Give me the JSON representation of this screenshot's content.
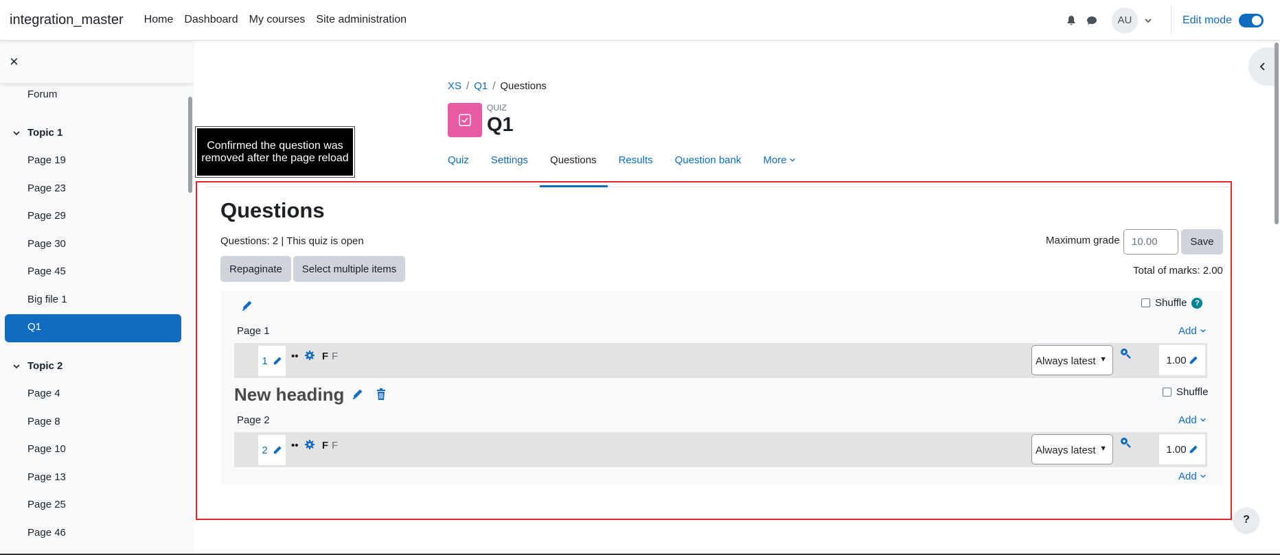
{
  "topnav": {
    "site_name": "integration_master",
    "links": [
      "Home",
      "Dashboard",
      "My courses",
      "Site administration"
    ],
    "user_initials": "AU",
    "edit_mode_label": "Edit mode",
    "edit_mode_on": true
  },
  "drawer": {
    "close_icon": "×",
    "items": [
      {
        "type": "item",
        "label": "Forum"
      },
      {
        "type": "section",
        "label": "Topic 1"
      },
      {
        "type": "item",
        "label": "Page 19"
      },
      {
        "type": "item",
        "label": "Page 23"
      },
      {
        "type": "item",
        "label": "Page 29"
      },
      {
        "type": "item",
        "label": "Page 30"
      },
      {
        "type": "item",
        "label": "Page 45"
      },
      {
        "type": "item",
        "label": "Big file 1"
      },
      {
        "type": "active",
        "label": "Q1"
      },
      {
        "type": "section",
        "label": "Topic 2"
      },
      {
        "type": "item",
        "label": "Page 4"
      },
      {
        "type": "item",
        "label": "Page 8"
      },
      {
        "type": "item",
        "label": "Page 10"
      },
      {
        "type": "item",
        "label": "Page 13"
      },
      {
        "type": "item",
        "label": "Page 25"
      },
      {
        "type": "item",
        "label": "Page 46"
      }
    ]
  },
  "tooltip": "Confirmed the question was removed after the page reload",
  "breadcrumb": [
    "XS",
    "Q1",
    "Questions"
  ],
  "activity": {
    "type_label": "QUIZ",
    "title": "Q1",
    "icon_color": "#e95aa5"
  },
  "tabs": [
    "Quiz",
    "Settings",
    "Questions",
    "Results",
    "Question bank",
    "More"
  ],
  "active_tab": "Questions",
  "questions": {
    "heading": "Questions",
    "status": "Questions: 2 | This quiz is open",
    "repaginate_label": "Repaginate",
    "select_multiple_label": "Select multiple items",
    "max_grade_label": "Maximum grade",
    "max_grade_value": "10.00",
    "save_label": "Save",
    "total_marks": "Total of marks: 2.00",
    "shuffle_label": "Shuffle",
    "add_label": "Add",
    "section_heading": "New heading",
    "pages": [
      {
        "label": "Page 1",
        "slot_number": "1",
        "qtype": "F",
        "qname": "F",
        "version": "Always latest",
        "mark": "1.00"
      },
      {
        "label": "Page 2",
        "slot_number": "2",
        "qtype": "F",
        "qname": "F",
        "version": "Always latest",
        "mark": "1.00"
      }
    ]
  },
  "colors": {
    "accent": "#0f6cbf",
    "highlight_box": "#e0242a"
  }
}
